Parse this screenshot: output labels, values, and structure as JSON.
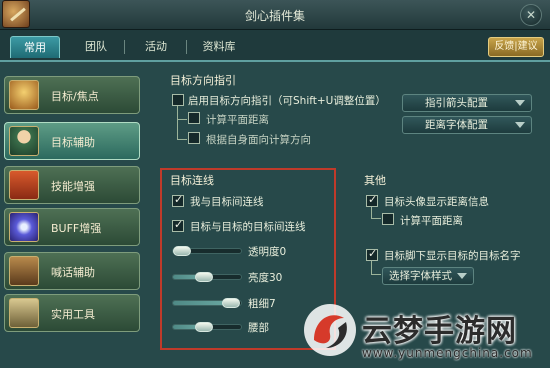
{
  "window": {
    "title": "剑心插件集",
    "close_icon": "close-icon"
  },
  "tabs": [
    {
      "label": "常用",
      "active": true
    },
    {
      "label": "团队",
      "active": false
    },
    {
      "label": "活动",
      "active": false
    },
    {
      "label": "资料库",
      "active": false
    }
  ],
  "feedback_label": "反馈|建议",
  "sidebar": {
    "items": [
      {
        "label": "目标/焦点",
        "icon": "target-icon",
        "active": false
      },
      {
        "label": "目标辅助",
        "icon": "assist-icon",
        "active": true
      },
      {
        "label": "技能增强",
        "icon": "skill-icon",
        "active": false
      },
      {
        "label": "BUFF增强",
        "icon": "buff-icon",
        "active": false
      },
      {
        "label": "喊话辅助",
        "icon": "shout-icon",
        "active": false
      },
      {
        "label": "实用工具",
        "icon": "tool-icon",
        "active": false
      }
    ]
  },
  "direction": {
    "title": "目标方向指引",
    "enable": {
      "label": "启用目标方向指引（可Shift+U调整位置）",
      "checked": false
    },
    "plane": {
      "label": "计算平面距离",
      "checked": false
    },
    "facing": {
      "label": "根据自身面向计算方向",
      "checked": false
    },
    "arrow_dropdown": "指引箭头配置",
    "font_dropdown": "距离字体配置"
  },
  "link": {
    "title": "目标连线",
    "self_link": {
      "label": "我与目标间连线",
      "checked": true
    },
    "tt_link": {
      "label": "目标与目标的目标间连线",
      "checked": true
    },
    "sliders": [
      {
        "label": "透明度0",
        "value": 0.12
      },
      {
        "label": "亮度30",
        "value": 0.45
      },
      {
        "label": "粗细7",
        "value": 0.85
      },
      {
        "label": "腰部",
        "value": 0.45
      }
    ]
  },
  "other": {
    "title": "其他",
    "avatar_distance": {
      "label": "目标头像显示距离信息",
      "checked": true
    },
    "plane_distance": {
      "label": "计算平面距离",
      "checked": false
    },
    "foot_name": {
      "label": "目标脚下显示目标的目标名字",
      "checked": true
    },
    "font_style_dropdown": "选择字体样式"
  },
  "watermark": {
    "brand": "云梦手游网",
    "url": "www.yunmengchina.com"
  },
  "colors": {
    "highlight_box": "#c03a2a",
    "active_tab": "#2a848e",
    "panel": "#27494a"
  }
}
